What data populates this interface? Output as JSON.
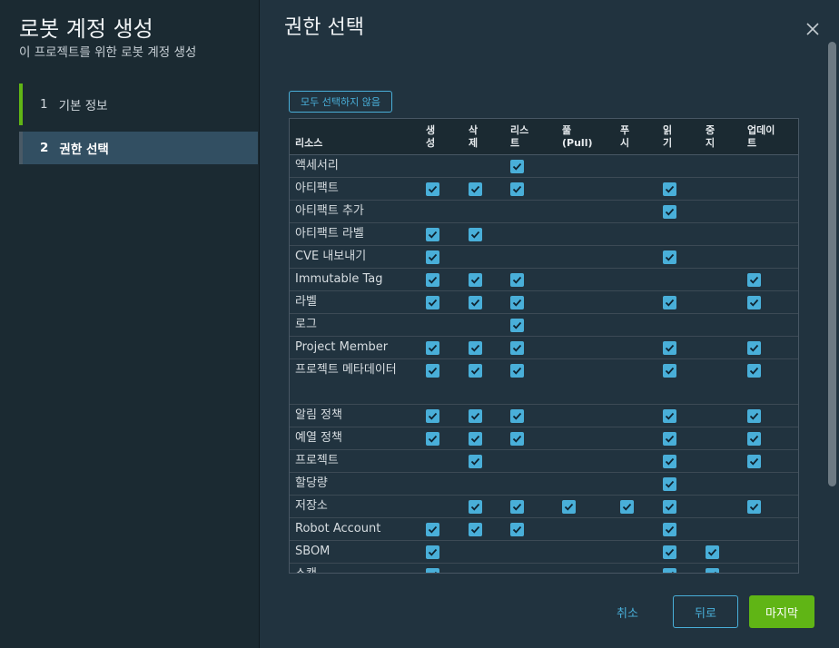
{
  "wizard": {
    "title": "로봇 계정 생성",
    "subtitle": "이 프로젝트를 위한 로봇 계정 생성",
    "steps": [
      {
        "num": "1",
        "label": "기본 정보",
        "state": "done"
      },
      {
        "num": "2",
        "label": "권한 선택",
        "state": "active"
      }
    ]
  },
  "main": {
    "title": "권한 선택",
    "deselect_all": "모두 선택하지 않음"
  },
  "grid": {
    "resource_header": "리소스",
    "columns": [
      {
        "key": "create",
        "label": "생\n성"
      },
      {
        "key": "delete",
        "label": "삭\n제"
      },
      {
        "key": "list",
        "label": "리스\n트"
      },
      {
        "key": "pull",
        "label": "풀\n(Pull)"
      },
      {
        "key": "push",
        "label": "푸\n시"
      },
      {
        "key": "read",
        "label": "읽\n기"
      },
      {
        "key": "stop",
        "label": "중\n지"
      },
      {
        "key": "update",
        "label": "업데이\n트"
      }
    ],
    "rows": [
      {
        "name": "액세서리",
        "checked": [
          "list"
        ]
      },
      {
        "name": "아티팩트",
        "checked": [
          "create",
          "delete",
          "list",
          "read"
        ]
      },
      {
        "name": "아티팩트 추가",
        "checked": [
          "read"
        ]
      },
      {
        "name": "아티팩트 라벨",
        "checked": [
          "create",
          "delete"
        ]
      },
      {
        "name": "CVE 내보내기",
        "checked": [
          "create",
          "read"
        ]
      },
      {
        "name": "Immutable Tag",
        "checked": [
          "create",
          "delete",
          "list",
          "update"
        ]
      },
      {
        "name": "라벨",
        "checked": [
          "create",
          "delete",
          "list",
          "read",
          "update"
        ]
      },
      {
        "name": "로그",
        "checked": [
          "list"
        ]
      },
      {
        "name": "Project Member",
        "checked": [
          "create",
          "delete",
          "list",
          "read",
          "update"
        ]
      },
      {
        "name": "프로젝트 메타데이터",
        "checked": [
          "create",
          "delete",
          "list",
          "read",
          "update"
        ],
        "tall": true
      },
      {
        "name": "알림 정책",
        "checked": [
          "create",
          "delete",
          "list",
          "read",
          "update"
        ]
      },
      {
        "name": "예열 정책",
        "checked": [
          "create",
          "delete",
          "list",
          "read",
          "update"
        ]
      },
      {
        "name": "프로젝트",
        "checked": [
          "delete",
          "read",
          "update"
        ]
      },
      {
        "name": "할당량",
        "checked": [
          "read"
        ]
      },
      {
        "name": "저장소",
        "checked": [
          "delete",
          "list",
          "pull",
          "push",
          "read",
          "update"
        ]
      },
      {
        "name": "Robot Account",
        "checked": [
          "create",
          "delete",
          "list",
          "read"
        ]
      },
      {
        "name": "SBOM",
        "checked": [
          "create",
          "read",
          "stop"
        ]
      },
      {
        "name": "스캔",
        "checked": [
          "create",
          "read",
          "stop"
        ]
      }
    ]
  },
  "footer": {
    "cancel": "취소",
    "back": "뒤로",
    "finish": "마지막"
  },
  "colors": {
    "accent": "#49afd9",
    "success": "#60b515",
    "background": "#21333f",
    "sidebar": "#1b2a32"
  }
}
